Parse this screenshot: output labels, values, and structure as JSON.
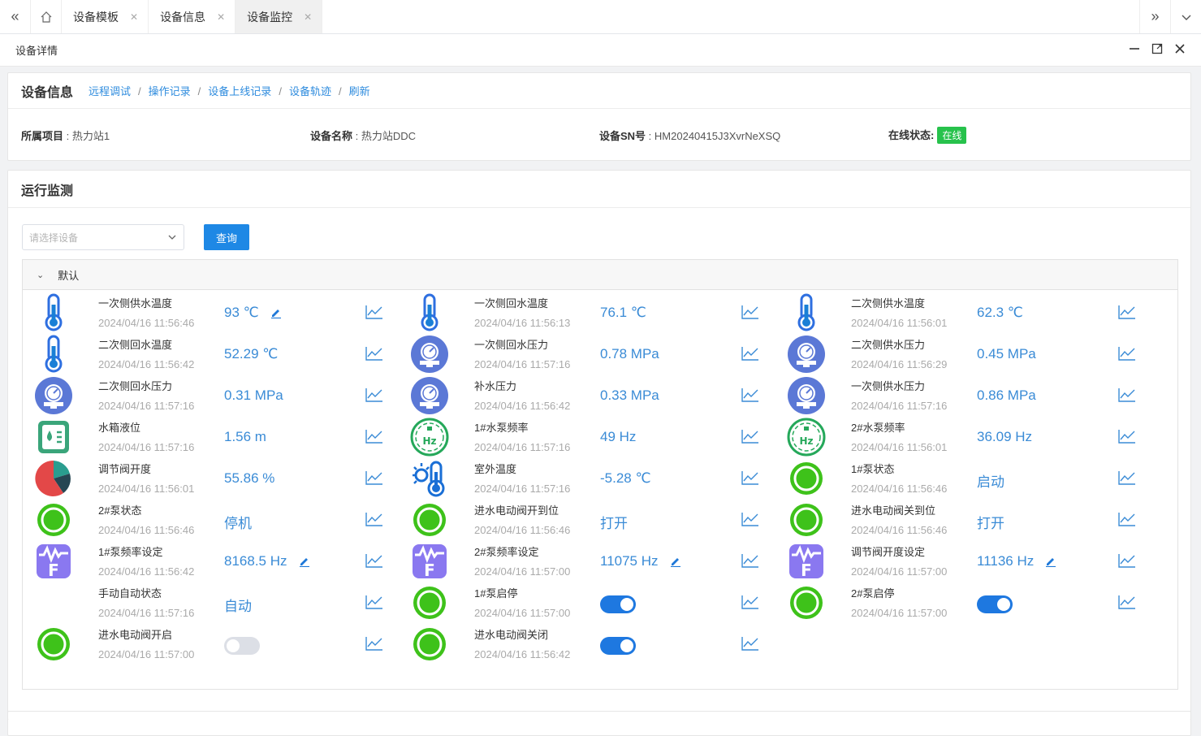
{
  "tabs": {
    "items": [
      {
        "label": "设备模板"
      },
      {
        "label": "设备信息"
      },
      {
        "label": "设备监控"
      }
    ]
  },
  "panel": {
    "title": "设备详情"
  },
  "device_info": {
    "heading": "设备信息",
    "links": [
      "远程调试",
      "操作记录",
      "设备上线记录",
      "设备轨迹",
      "刷新"
    ],
    "fields": [
      {
        "label": "所属项目",
        "value": "热力站1"
      },
      {
        "label": "设备名称",
        "value": "热力站DDC"
      },
      {
        "label": "设备SN号",
        "value": "HM20240415J3XvrNeXSQ"
      },
      {
        "label": "在线状态:",
        "value": "在线"
      }
    ],
    "status_color": "#27c24c"
  },
  "monitor": {
    "heading": "运行监测",
    "select_placeholder": "请选择设备",
    "query_label": "查询",
    "group_label": "默认",
    "accent_color": "#1e88e5",
    "items": [
      {
        "icon": "thermometer",
        "name": "一次侧供水温度",
        "time": "2024/04/16 11:56:46",
        "value": "93 ℃",
        "editable": true
      },
      {
        "icon": "thermometer",
        "name": "一次侧回水温度",
        "time": "2024/04/16 11:56:13",
        "value": "76.1 ℃"
      },
      {
        "icon": "thermometer",
        "name": "二次侧供水温度",
        "time": "2024/04/16 11:56:01",
        "value": "62.3 ℃"
      },
      {
        "icon": "thermometer",
        "name": "二次侧回水温度",
        "time": "2024/04/16 11:56:42",
        "value": "52.29 ℃"
      },
      {
        "icon": "pressure",
        "name": "一次侧回水压力",
        "time": "2024/04/16 11:57:16",
        "value": "0.78 MPa"
      },
      {
        "icon": "pressure",
        "name": "二次侧供水压力",
        "time": "2024/04/16 11:56:29",
        "value": "0.45 MPa"
      },
      {
        "icon": "pressure",
        "name": "二次侧回水压力",
        "time": "2024/04/16 11:57:16",
        "value": "0.31 MPa"
      },
      {
        "icon": "pressure",
        "name": "补水压力",
        "time": "2024/04/16 11:56:42",
        "value": "0.33 MPa"
      },
      {
        "icon": "pressure",
        "name": "一次侧供水压力",
        "time": "2024/04/16 11:57:16",
        "value": "0.86 MPa"
      },
      {
        "icon": "tank",
        "name": "水箱液位",
        "time": "2024/04/16 11:57:16",
        "value": "1.56 m"
      },
      {
        "icon": "hz",
        "name": "1#水泵频率",
        "time": "2024/04/16 11:57:16",
        "value": "49 Hz"
      },
      {
        "icon": "hz",
        "name": "2#水泵频率",
        "time": "2024/04/16 11:56:01",
        "value": "36.09 Hz"
      },
      {
        "icon": "pie",
        "name": "调节阀开度",
        "time": "2024/04/16 11:56:01",
        "value": "55.86 %"
      },
      {
        "icon": "outdoor",
        "name": "室外温度",
        "time": "2024/04/16 11:57:16",
        "value": "-5.28 ℃"
      },
      {
        "icon": "status",
        "name": "1#泵状态",
        "time": "2024/04/16 11:56:46",
        "value": "启动"
      },
      {
        "icon": "status",
        "name": "2#泵状态",
        "time": "2024/04/16 11:56:46",
        "value": "停机"
      },
      {
        "icon": "status",
        "name": "进水电动阀开到位",
        "time": "2024/04/16 11:56:46",
        "value": "打开"
      },
      {
        "icon": "status",
        "name": "进水电动阀关到位",
        "time": "2024/04/16 11:56:46",
        "value": "打开"
      },
      {
        "icon": "freq",
        "name": "1#泵频率设定",
        "time": "2024/04/16 11:56:42",
        "value": "8168.5 Hz",
        "editable": true
      },
      {
        "icon": "freq",
        "name": "2#泵频率设定",
        "time": "2024/04/16 11:57:00",
        "value": "11075 Hz",
        "editable": true
      },
      {
        "icon": "freq",
        "name": "调节阀开度设定",
        "time": "2024/04/16 11:57:00",
        "value": "11136 Hz",
        "editable": true
      },
      {
        "icon": "none",
        "name": "手动自动状态",
        "time": "2024/04/16 11:57:16",
        "value": "自动"
      },
      {
        "icon": "status",
        "name": "1#泵启停",
        "time": "2024/04/16 11:57:00",
        "switch": "on"
      },
      {
        "icon": "status",
        "name": "2#泵启停",
        "time": "2024/04/16 11:57:00",
        "switch": "on"
      },
      {
        "icon": "status",
        "name": "进水电动阀开启",
        "time": "2024/04/16 11:57:00",
        "switch": "off"
      },
      {
        "icon": "status",
        "name": "进水电动阀关闭",
        "time": "2024/04/16 11:56:42",
        "switch": "on"
      }
    ]
  }
}
